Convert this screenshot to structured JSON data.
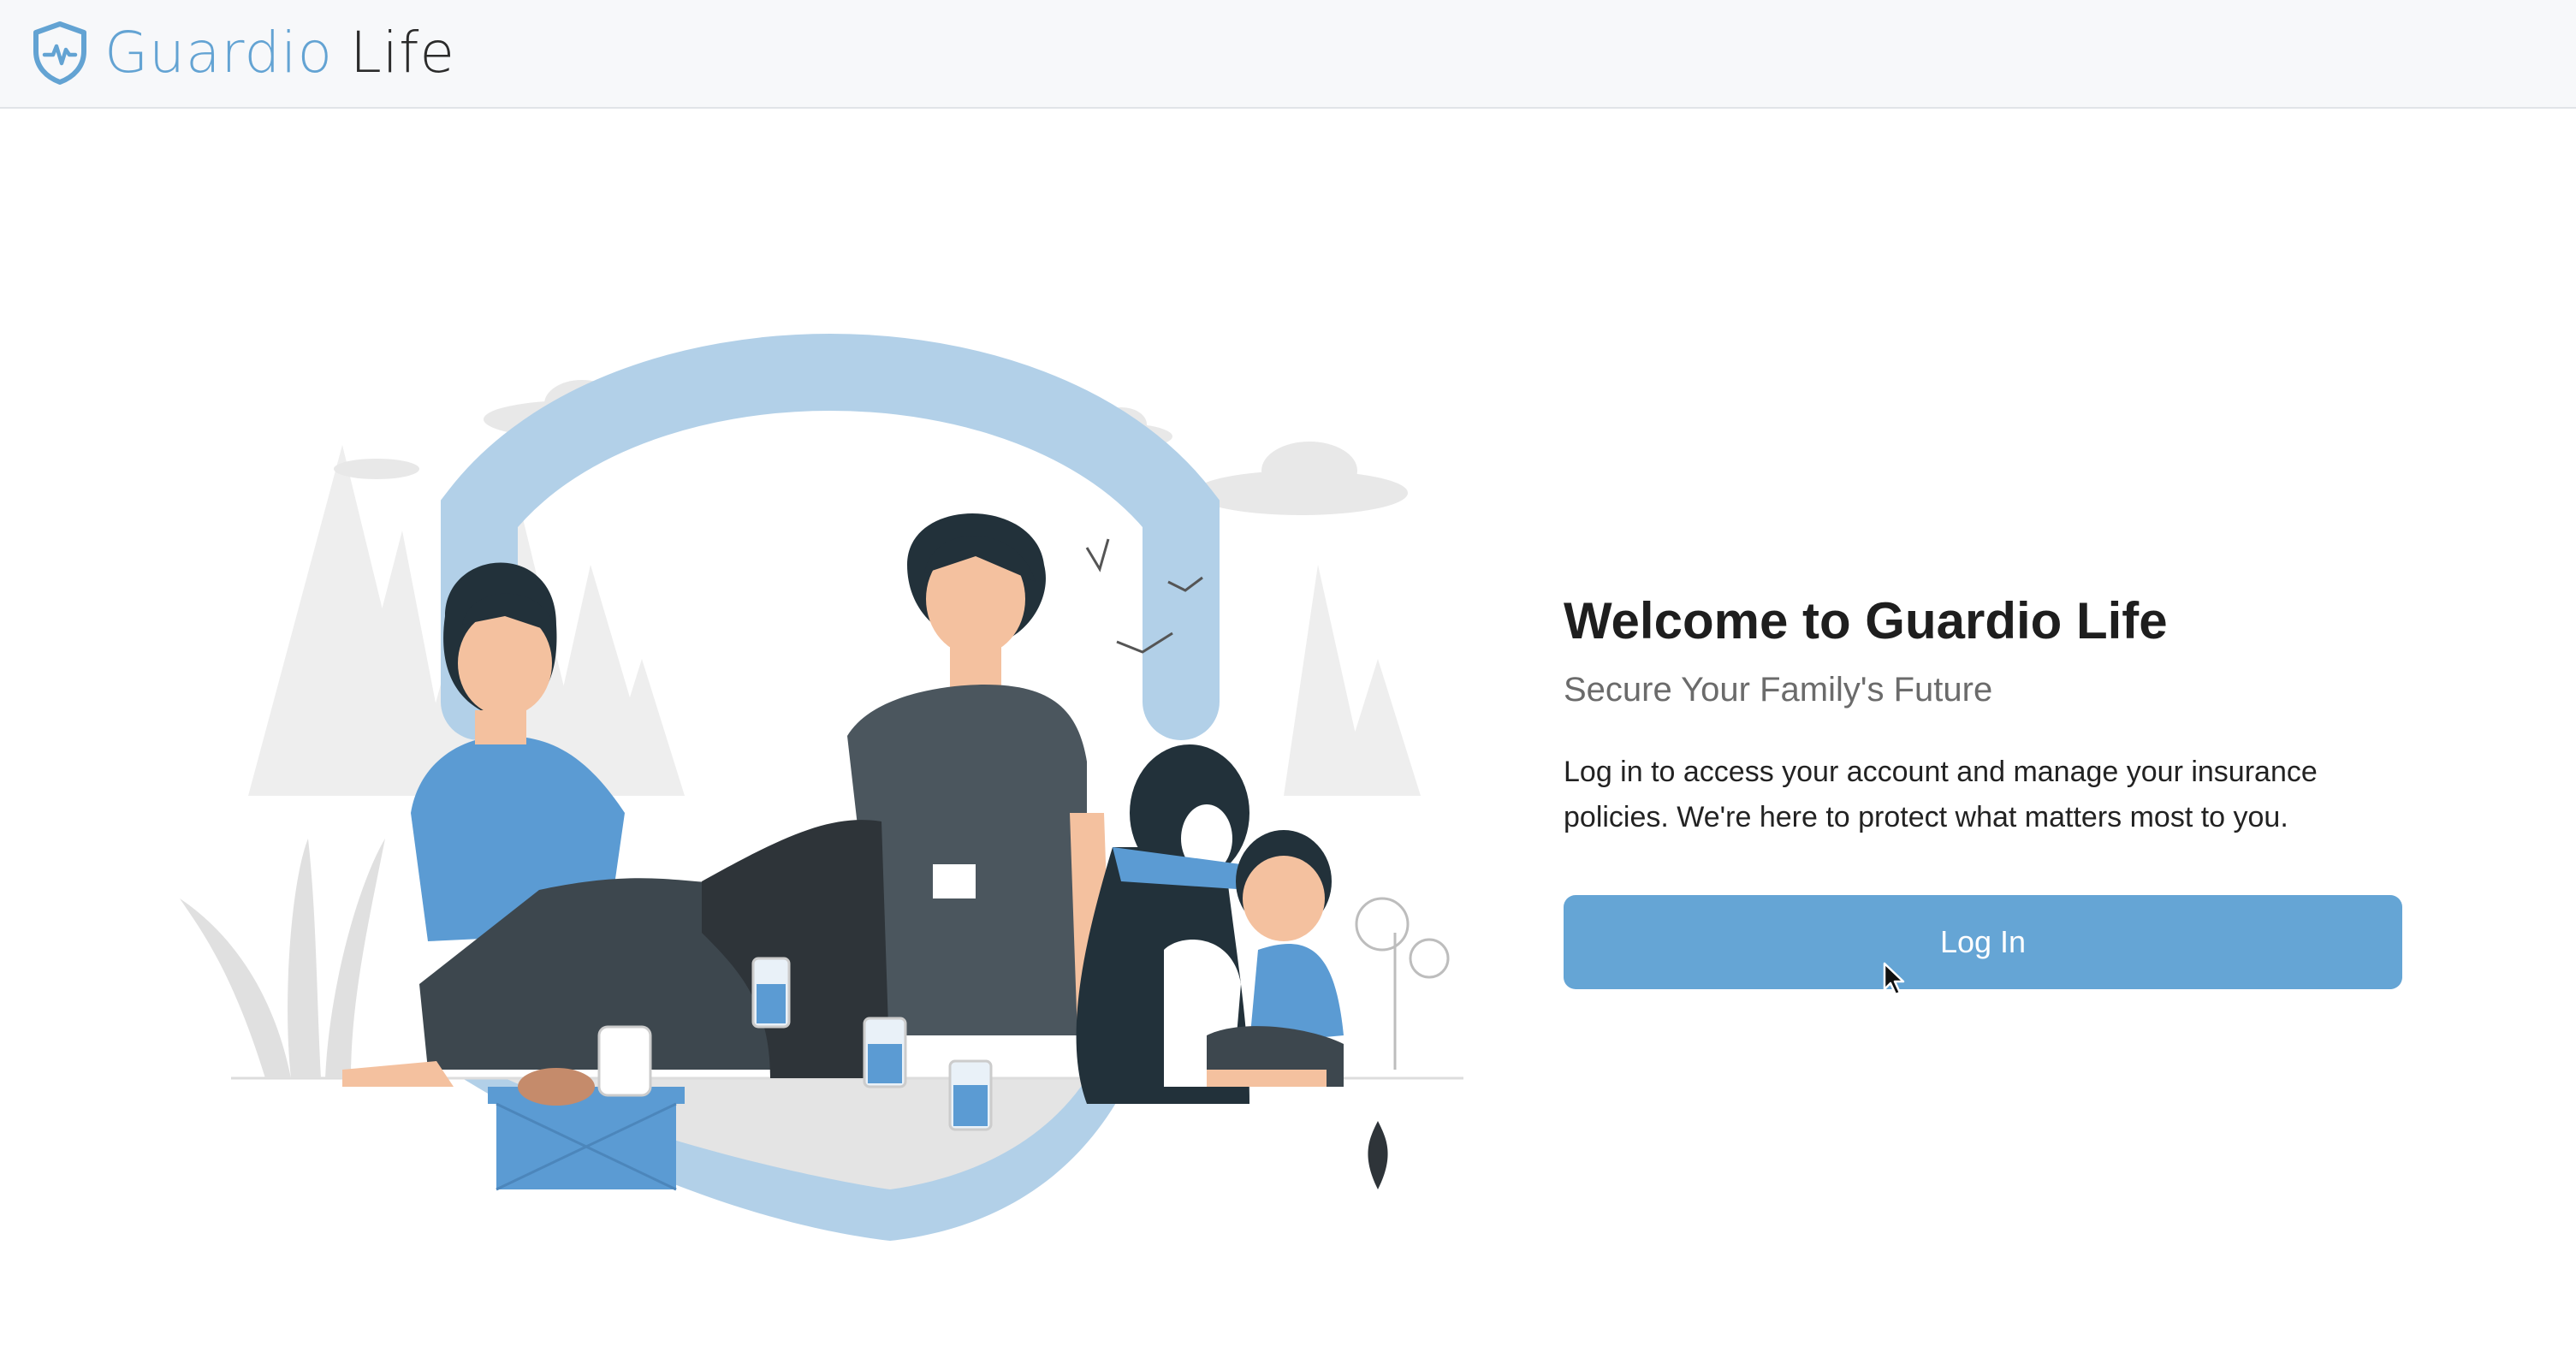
{
  "header": {
    "brand_part1": "Guardio",
    "brand_part2": "Life",
    "logo_icon": "shield-heartbeat-icon"
  },
  "hero": {
    "illustration": "family-picnic-illustration",
    "title": "Welcome to Guardio Life",
    "subtitle": "Secure Your Family's Future",
    "description": "Log in to access your account and manage your insurance policies. We're here to protect what matters most to you.",
    "login_label": "Log In"
  },
  "colors": {
    "brand_blue": "#65a5d5",
    "header_bg": "#f7f8fa",
    "title_color": "#1e1e1e"
  }
}
